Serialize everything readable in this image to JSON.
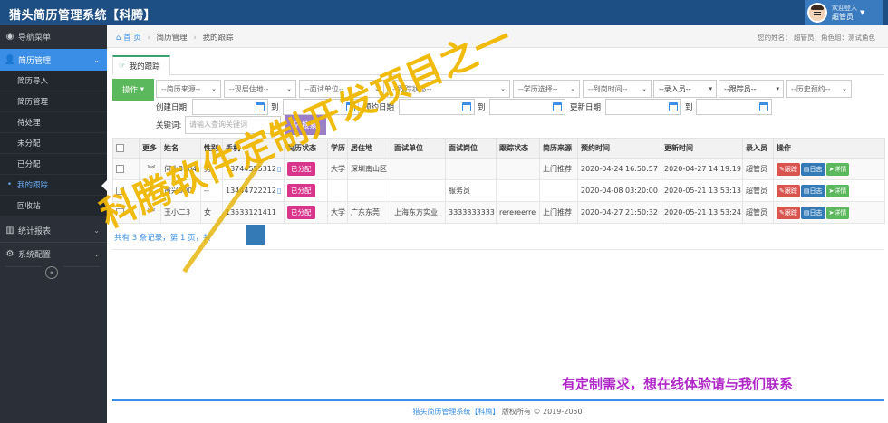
{
  "app": {
    "title": "猎头简历管理系统【科腾】"
  },
  "user": {
    "welcome": "欢迎登入",
    "name": "超管员"
  },
  "sidebar": {
    "nav_menu": "导航菜单",
    "resume_mgmt": "简历管理",
    "subitems": [
      "简历导入",
      "简历管理",
      "待处理",
      "未分配",
      "已分配",
      "我的跟踪",
      "回收站"
    ],
    "stats": "统计报表",
    "config": "系统配置"
  },
  "breadcrumb": {
    "home": "首 页",
    "level1": "简历管理",
    "level2": "我的跟踪"
  },
  "role_info": "您的姓名：  超管员，角色组：测试角色",
  "tab": {
    "label": "我的跟踪"
  },
  "filters": {
    "op": "操作",
    "source": "--简历来源--",
    "location": "--现居住地--",
    "company": "--面试单位--",
    "track_status": "--跟踪状态--",
    "edu": "--学历选择--",
    "arrival": "--到岗时间--",
    "entry_user": "--录入员--",
    "tracker": "--跟踪员--",
    "history": "--历史预约--",
    "created_date": "创建日期",
    "to1": "到",
    "appt_date": "预约日期",
    "to2": "到",
    "updated_date": "更新日期",
    "to3": "到",
    "keyword_label": "关键词:",
    "keyword_placeholder": "请输入查询关键词",
    "search": "搜索"
  },
  "table": {
    "headers": [
      "",
      "更多",
      "姓名",
      "性别",
      "手机",
      "简历状态",
      "学历",
      "居住地",
      "面试单位",
      "面试岗位",
      "跟踪状态",
      "简历来源",
      "预约时间",
      "更新时间",
      "录入员",
      "操作"
    ],
    "rows": [
      {
        "name": "何小3004",
        "gender": "男",
        "phone": "13744555312",
        "status": "已分配",
        "edu": "大学",
        "loc": "深圳南山区",
        "company": "",
        "post": "",
        "track": "",
        "source": "上门推荐",
        "appt": "2020-04-24 16:50:57",
        "updated": "2020-04-27 14:19:19",
        "entry": "超管员"
      },
      {
        "name": "黄兴300",
        "gender": "--",
        "phone": "13444722212",
        "status": "已分配",
        "edu": "",
        "loc": "",
        "company": "",
        "post": "服务员",
        "track": "",
        "source": "",
        "appt": "2020-04-08 03:20:00",
        "updated": "2020-05-21 13:53:13",
        "entry": "超管员"
      },
      {
        "name": "王小二3",
        "gender": "女",
        "phone": "13533121411",
        "status": "已分配",
        "edu": "大学",
        "loc": "广东东莞",
        "company": "上海东方实业",
        "post": "3333333333",
        "track": "rerereerre",
        "source": "上门推荐",
        "appt": "2020-04-27 21:50:32",
        "updated": "2020-05-21 13:53:24",
        "entry": "超管员"
      }
    ],
    "actions": {
      "track": "跟踪",
      "log": "日志",
      "detail": "详情"
    }
  },
  "pager": {
    "summary": "共有 3 条记录，第 1 页，共"
  },
  "watermark": "科腾软件定制开发项目之一",
  "promo": "有定制需求，想在线体验请与我们联系",
  "footer": {
    "system": "猎头简历管理系统【科腾】",
    "rights": "版权所有 © 2019-2050"
  },
  "colors": {
    "topbar": "#1e4f84",
    "sidebar": "#2b2f37",
    "accent": "#3a8ee6",
    "status": "#d9368b",
    "watermark": "#f0b800",
    "promo": "#b026c8"
  }
}
